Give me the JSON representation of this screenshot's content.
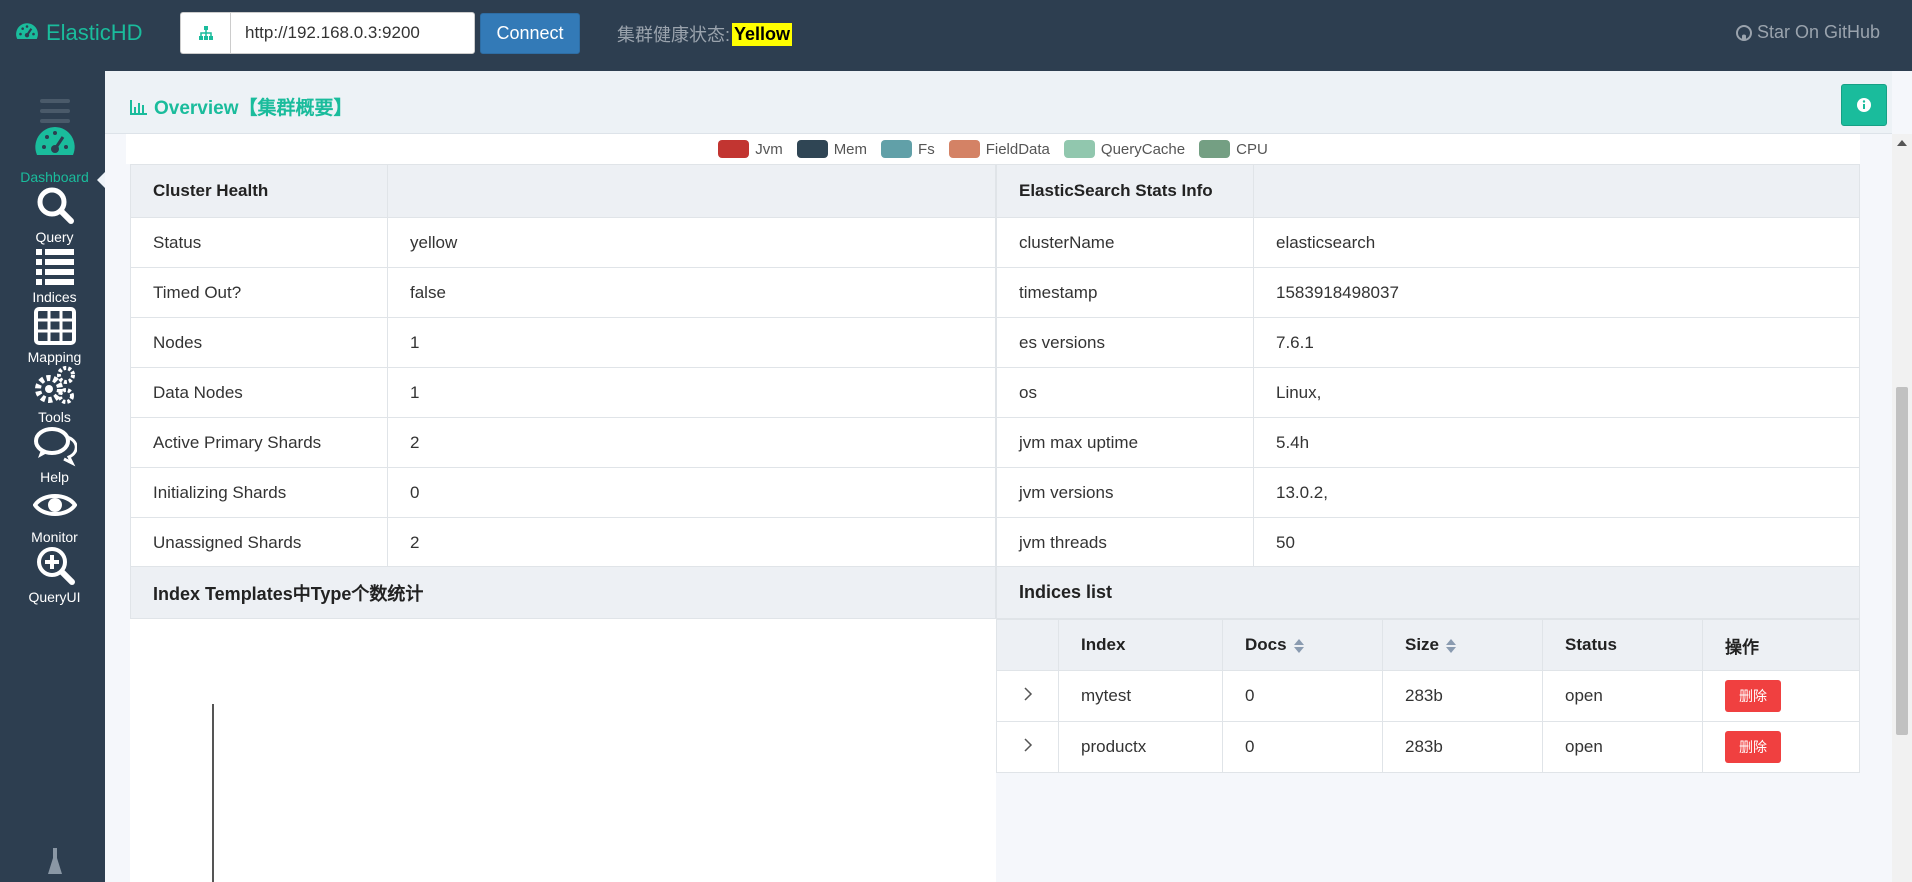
{
  "app": {
    "brand": "ElasticHD",
    "url_value": "http://192.168.0.3:9200",
    "connect_label": "Connect",
    "health_label": "集群健康状态:",
    "health_status": "Yellow",
    "github_label": "Star On GitHub"
  },
  "sidebar": {
    "items": [
      {
        "label": "Dashboard",
        "icon": "dashboard-icon"
      },
      {
        "label": "Query",
        "icon": "search-icon"
      },
      {
        "label": "Indices",
        "icon": "list-icon"
      },
      {
        "label": "Mapping",
        "icon": "table-icon"
      },
      {
        "label": "Tools",
        "icon": "gears-icon"
      },
      {
        "label": "Help",
        "icon": "comments-icon"
      },
      {
        "label": "Monitor",
        "icon": "eye-icon"
      },
      {
        "label": "QueryUI",
        "icon": "search-plus-icon"
      }
    ]
  },
  "page": {
    "title": "Overview【集群概要】"
  },
  "legend": [
    {
      "label": "Jvm",
      "color": "#c23531"
    },
    {
      "label": "Mem",
      "color": "#2f4554"
    },
    {
      "label": "Fs",
      "color": "#61a0a8"
    },
    {
      "label": "FieldData",
      "color": "#d48265"
    },
    {
      "label": "QueryCache",
      "color": "#91c7ae"
    },
    {
      "label": "CPU",
      "color": "#749f83"
    }
  ],
  "cluster_health": {
    "title": "Cluster Health",
    "rows": [
      {
        "k": "Status",
        "v": "yellow"
      },
      {
        "k": "Timed Out?",
        "v": "false"
      },
      {
        "k": "Nodes",
        "v": "1"
      },
      {
        "k": "Data Nodes",
        "v": "1"
      },
      {
        "k": "Active Primary Shards",
        "v": "2"
      },
      {
        "k": "Initializing Shards",
        "v": "0"
      },
      {
        "k": "Unassigned Shards",
        "v": "2"
      }
    ]
  },
  "stats_info": {
    "title": "ElasticSearch Stats Info",
    "rows": [
      {
        "k": "clusterName",
        "v": "elasticsearch"
      },
      {
        "k": "timestamp",
        "v": "1583918498037"
      },
      {
        "k": "es versions",
        "v": "7.6.1"
      },
      {
        "k": "os",
        "v": "Linux,"
      },
      {
        "k": "jvm max uptime",
        "v": "5.4h"
      },
      {
        "k": "jvm versions",
        "v": "13.0.2,"
      },
      {
        "k": "jvm threads",
        "v": "50"
      }
    ]
  },
  "templates_panel": {
    "title": "Index Templates中Type个数统计"
  },
  "indices": {
    "title": "Indices list",
    "columns": [
      "Index",
      "Docs",
      "Size",
      "Status",
      "操作"
    ],
    "delete_label": "删除",
    "rows": [
      {
        "index": "mytest",
        "docs": "0",
        "size": "283b",
        "status": "open"
      },
      {
        "index": "productx",
        "docs": "0",
        "size": "283b",
        "status": "open"
      }
    ]
  }
}
